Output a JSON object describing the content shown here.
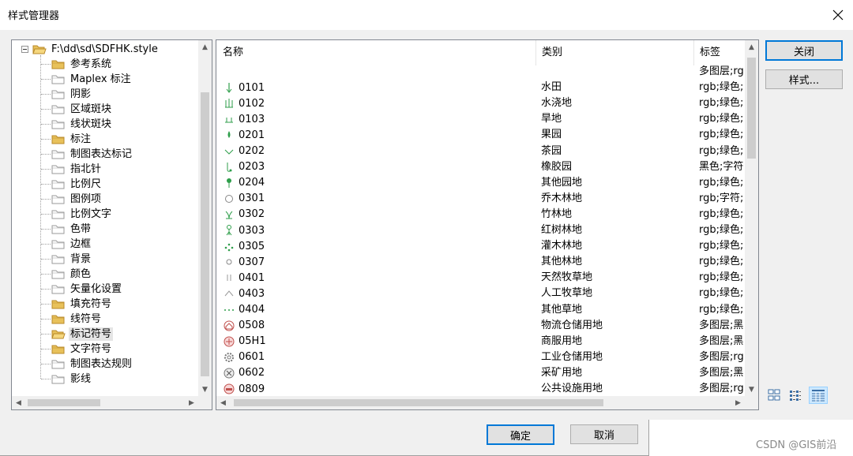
{
  "window": {
    "title": "样式管理器",
    "close_glyph": "✕"
  },
  "tree": {
    "root": "F:\\dd\\sd\\SDFHK.style",
    "items": [
      {
        "label": "参考系统",
        "filled": true
      },
      {
        "label": "Maplex 标注",
        "filled": false
      },
      {
        "label": "阴影",
        "filled": false
      },
      {
        "label": "区域斑块",
        "filled": false
      },
      {
        "label": "线状斑块",
        "filled": false
      },
      {
        "label": "标注",
        "filled": true
      },
      {
        "label": "制图表达标记",
        "filled": false
      },
      {
        "label": "指北针",
        "filled": false
      },
      {
        "label": "比例尺",
        "filled": false
      },
      {
        "label": "图例项",
        "filled": false
      },
      {
        "label": "比例文字",
        "filled": false
      },
      {
        "label": "色带",
        "filled": false
      },
      {
        "label": "边框",
        "filled": false
      },
      {
        "label": "背景",
        "filled": false
      },
      {
        "label": "颜色",
        "filled": false
      },
      {
        "label": "矢量化设置",
        "filled": false
      },
      {
        "label": "填充符号",
        "filled": true
      },
      {
        "label": "线符号",
        "filled": true
      },
      {
        "label": "标记符号",
        "filled": true,
        "open": true,
        "selected": true
      },
      {
        "label": "文字符号",
        "filled": true
      },
      {
        "label": "制图表达规则",
        "filled": false
      },
      {
        "label": "影线",
        "filled": false
      }
    ]
  },
  "list": {
    "columns": [
      "名称",
      "类别",
      "标签"
    ],
    "rows": [
      {
        "icon": "none",
        "name": "",
        "category": "",
        "tag": "多图层;rg"
      },
      {
        "icon": "arrow-down-icon",
        "name": "0101",
        "category": "水田",
        "tag": "rgb;绿色;"
      },
      {
        "icon": "grass-double-icon",
        "name": "0102",
        "category": "水浇地",
        "tag": "rgb;绿色;"
      },
      {
        "icon": "grass-short-icon",
        "name": "0103",
        "category": "旱地",
        "tag": "rgb;绿色;"
      },
      {
        "icon": "drop-icon",
        "name": "0201",
        "category": "果园",
        "tag": "rgb;绿色;"
      },
      {
        "icon": "chevron-down-icon",
        "name": "0202",
        "category": "茶园",
        "tag": "rgb;绿色;"
      },
      {
        "icon": "hook-icon",
        "name": "0203",
        "category": "橡胶园",
        "tag": "黑色;字符"
      },
      {
        "icon": "pin-icon",
        "name": "0204",
        "category": "其他园地",
        "tag": "rgb;绿色;"
      },
      {
        "icon": "circle-icon",
        "name": "0301",
        "category": "乔木林地",
        "tag": "rgb;字符;"
      },
      {
        "icon": "bamboo-icon",
        "name": "0302",
        "category": "竹林地",
        "tag": "rgb;绿色;"
      },
      {
        "icon": "mangrove-icon",
        "name": "0303",
        "category": "红树林地",
        "tag": "rgb;绿色;"
      },
      {
        "icon": "shrub-icon",
        "name": "0305",
        "category": "灌木林地",
        "tag": "rgb;绿色;"
      },
      {
        "icon": "small-circle-icon",
        "name": "0307",
        "category": "其他林地",
        "tag": "rgb;绿色;"
      },
      {
        "icon": "double-bar-icon",
        "name": "0401",
        "category": "天然牧草地",
        "tag": "rgb;绿色;"
      },
      {
        "icon": "caret-up-icon",
        "name": "0403",
        "category": "人工牧草地",
        "tag": "rgb;绿色;"
      },
      {
        "icon": "dots-icon",
        "name": "0404",
        "category": "其他草地",
        "tag": "rgb;绿色;"
      },
      {
        "icon": "warehouse-icon",
        "name": "0508",
        "category": "物流仓储用地",
        "tag": "多图层;黑"
      },
      {
        "icon": "commerce-icon",
        "name": "05H1",
        "category": "商服用地",
        "tag": "多图层;黑"
      },
      {
        "icon": "gear-icon",
        "name": "0601",
        "category": "工业仓储用地",
        "tag": "多图层;rg"
      },
      {
        "icon": "mining-icon",
        "name": "0602",
        "category": "采矿用地",
        "tag": "多图层;黑"
      },
      {
        "icon": "facility-icon",
        "name": "0809",
        "category": "公共设施用地",
        "tag": "多图层;rg"
      }
    ]
  },
  "buttons": {
    "close": "关闭",
    "styles": "样式...",
    "ok": "确定",
    "cancel": "取消"
  },
  "view_icons": [
    "large-icons-view-icon",
    "list-view-icon",
    "details-view-icon"
  ],
  "watermark": "CSDN @GIS前沿",
  "colors": {
    "accent": "#0078d7",
    "symbol_green": "#2e9e4a",
    "symbol_red": "#c0504d",
    "folder": "#e8c15a"
  }
}
